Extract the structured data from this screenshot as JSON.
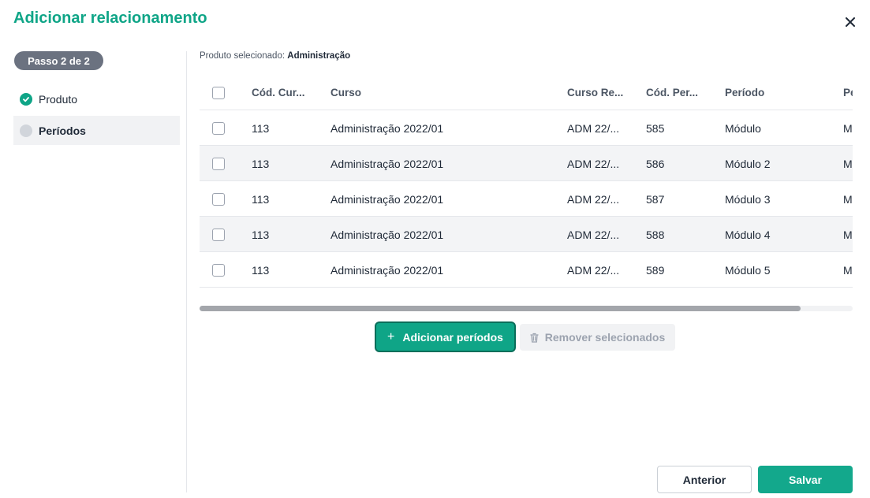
{
  "dialog": {
    "title": "Adicionar relacionamento"
  },
  "stepper": {
    "badge": "Passo 2 de 2",
    "steps": [
      {
        "label": "Produto",
        "status": "done"
      },
      {
        "label": "Períodos",
        "status": "current"
      }
    ]
  },
  "selected_product": {
    "label": "Produto selecionado:",
    "value": "Administração"
  },
  "table": {
    "headers": [
      "Cód. Cur...",
      "Curso",
      "Curso Re...",
      "Cód. Per...",
      "Período",
      "Pe"
    ],
    "rows": [
      {
        "cod_curso": "113",
        "curso": "Administração 2022/01",
        "curso_ref": "ADM 22/...",
        "cod_periodo": "585",
        "periodo": "Módulo",
        "extra": "M"
      },
      {
        "cod_curso": "113",
        "curso": "Administração 2022/01",
        "curso_ref": "ADM 22/...",
        "cod_periodo": "586",
        "periodo": "Módulo 2",
        "extra": "M"
      },
      {
        "cod_curso": "113",
        "curso": "Administração 2022/01",
        "curso_ref": "ADM 22/...",
        "cod_periodo": "587",
        "periodo": "Módulo 3",
        "extra": "M"
      },
      {
        "cod_curso": "113",
        "curso": "Administração 2022/01",
        "curso_ref": "ADM 22/...",
        "cod_periodo": "588",
        "periodo": "Módulo 4",
        "extra": "M"
      },
      {
        "cod_curso": "113",
        "curso": "Administração 2022/01",
        "curso_ref": "ADM 22/...",
        "cod_periodo": "589",
        "periodo": "Módulo 5",
        "extra": "M"
      }
    ]
  },
  "actions": {
    "add_label": "Adicionar períodos",
    "remove_label": "Remover selecionados"
  },
  "footer": {
    "prev_label": "Anterior",
    "save_label": "Salvar"
  },
  "colors": {
    "accent": "#0fa587",
    "muted": "#6b7280"
  },
  "icons": {
    "close": "close-icon",
    "done": "check-circle-icon",
    "pending": "circle-icon",
    "trash": "trash-icon",
    "plus": "plus-icon"
  }
}
